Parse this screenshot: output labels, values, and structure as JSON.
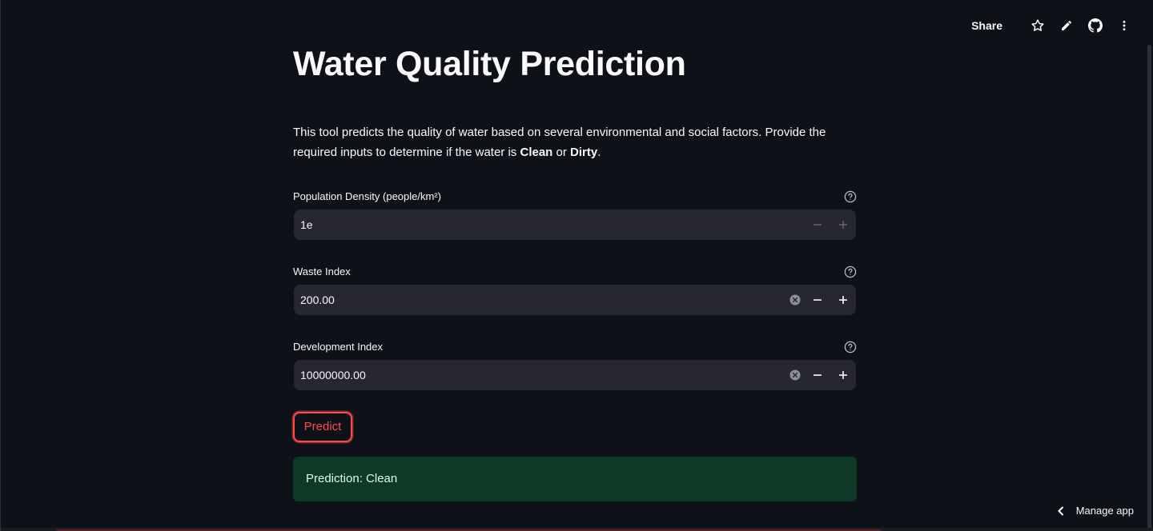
{
  "toolbar": {
    "share_label": "Share",
    "icons": [
      "star-icon",
      "pencil-icon",
      "github-icon",
      "more-vertical-icon"
    ]
  },
  "page": {
    "title": "Water Quality Prediction",
    "description_prefix": "This tool predicts the quality of water based on several environmental and social factors. Provide the required inputs to determine if the water is ",
    "description_clean": "Clean",
    "description_or": " or ",
    "description_dirty": "Dirty",
    "description_suffix": "."
  },
  "fields": [
    {
      "label": "Population Density (people/km²)",
      "value": "1e"
    },
    {
      "label": "Waste Index",
      "value": "200.00"
    },
    {
      "label": "Development Index",
      "value": "10000000.00"
    }
  ],
  "predict_label": "Predict",
  "result_text": "Prediction: Clean",
  "manage_app_label": "Manage app",
  "colors": {
    "background": "#0e1117",
    "input_bg": "#262730",
    "accent": "#ff4b4b",
    "success_bg": "#0c3a27"
  }
}
